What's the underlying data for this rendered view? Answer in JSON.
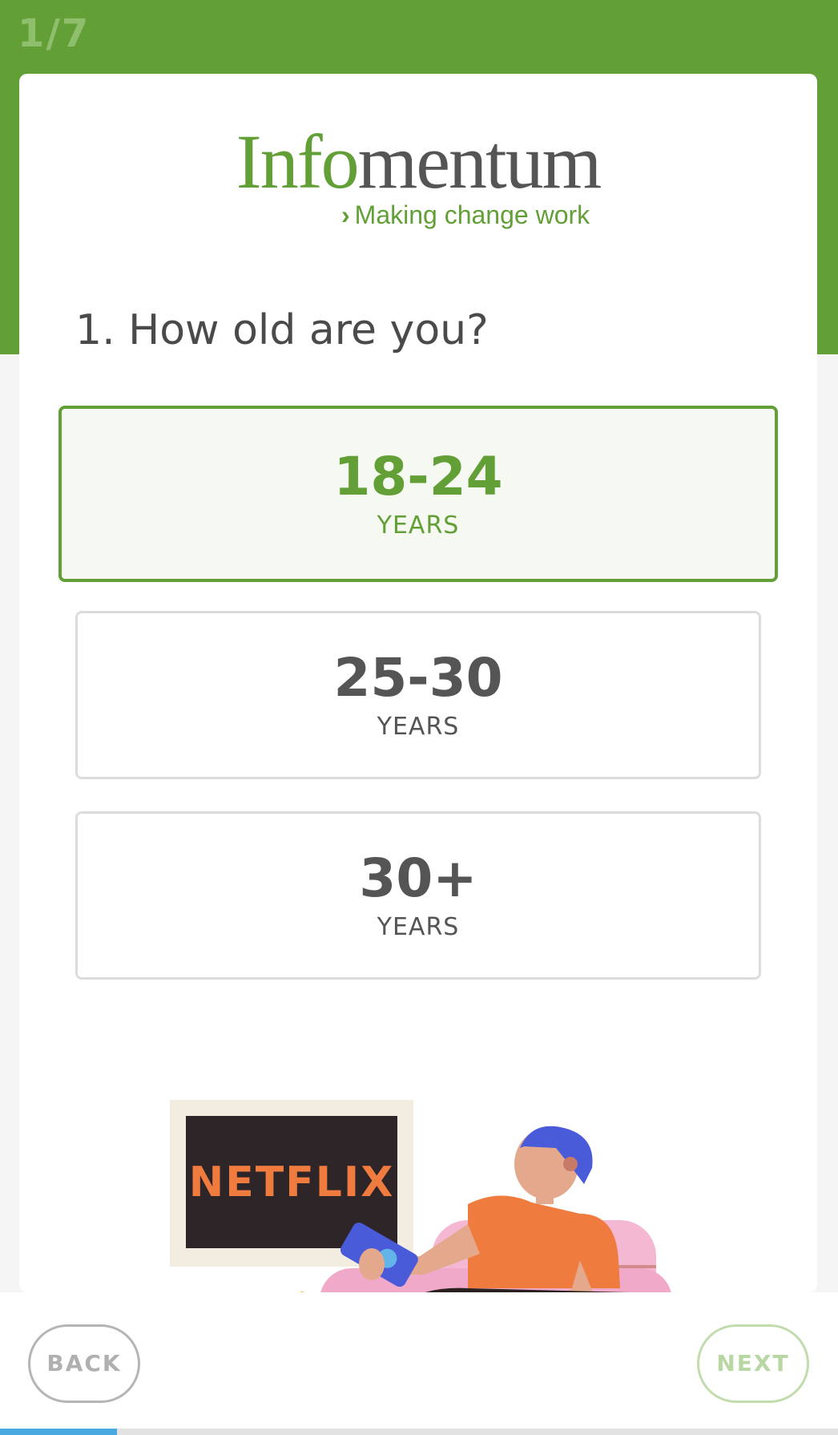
{
  "step": {
    "label": "1/7",
    "current": 1,
    "total": 7
  },
  "brand": {
    "logo_part1": "Info",
    "logo_part2": "mentum",
    "tagline": "Making change work",
    "colors": {
      "primary": "#629f37",
      "text": "#555555"
    }
  },
  "question": {
    "text": "1. How old are you?"
  },
  "options": [
    {
      "range": "18-24",
      "unit": "YEARS",
      "selected": true
    },
    {
      "range": "25-30",
      "unit": "YEARS",
      "selected": false
    },
    {
      "range": "30+",
      "unit": "YEARS",
      "selected": false
    }
  ],
  "illustration": {
    "tv_text": "NETFLIX"
  },
  "navigation": {
    "back_label": "BACK",
    "next_label": "NEXT"
  },
  "progress": {
    "fraction": 0.14
  }
}
